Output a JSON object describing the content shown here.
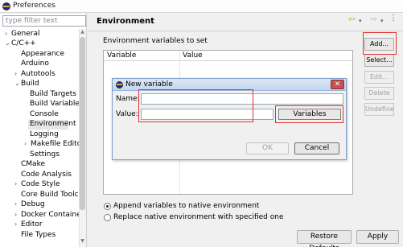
{
  "window": {
    "title": "Preferences"
  },
  "filter": {
    "placeholder": "type filter text"
  },
  "tree": {
    "items": [
      {
        "label": "General",
        "arrow": "›",
        "selected": false
      },
      {
        "label": "C/C++",
        "arrow": "⌄",
        "selected": false
      },
      {
        "label": "Appearance",
        "arrow": "",
        "selected": false
      },
      {
        "label": "Arduino",
        "arrow": "",
        "selected": false
      },
      {
        "label": "Autotools",
        "arrow": "›",
        "selected": false
      },
      {
        "label": "Build",
        "arrow": "⌄",
        "selected": false
      },
      {
        "label": "Build Targets",
        "arrow": "",
        "selected": false
      },
      {
        "label": "Build Variables",
        "arrow": "",
        "selected": false
      },
      {
        "label": "Console",
        "arrow": "",
        "selected": false
      },
      {
        "label": "Environment",
        "arrow": "",
        "selected": true
      },
      {
        "label": "Logging",
        "arrow": "",
        "selected": false
      },
      {
        "label": "Makefile Editor",
        "arrow": "›",
        "selected": false
      },
      {
        "label": "Settings",
        "arrow": "",
        "selected": false
      },
      {
        "label": "CMake",
        "arrow": "",
        "selected": false
      },
      {
        "label": "Code Analysis",
        "arrow": "",
        "selected": false
      },
      {
        "label": "Code Style",
        "arrow": "›",
        "selected": false
      },
      {
        "label": "Core Build Toolcha",
        "arrow": "",
        "selected": false
      },
      {
        "label": "Debug",
        "arrow": "›",
        "selected": false
      },
      {
        "label": "Docker Container",
        "arrow": "›",
        "selected": false
      },
      {
        "label": "Editor",
        "arrow": "›",
        "selected": false
      },
      {
        "label": "File Types",
        "arrow": "",
        "selected": false
      }
    ]
  },
  "page": {
    "title": "Environment"
  },
  "env": {
    "section_label": "Environment variables to set",
    "columns": [
      "Variable",
      "Value"
    ]
  },
  "buttons": {
    "add": "Add...",
    "select": "Select...",
    "edit": "Edit...",
    "delete": "Delete",
    "undefine": "Undefine"
  },
  "options": {
    "append": "Append variables to native environment",
    "replace": "Replace native environment with specified one",
    "selected": "append"
  },
  "footer": {
    "restore": "Restore Defaults",
    "apply": "Apply"
  },
  "dialog": {
    "title": "New variable",
    "name_label": "Name:",
    "name_value": "",
    "value_label": "Value:",
    "value_value": "",
    "variables_button": "Variables",
    "ok": "OK",
    "cancel": "Cancel",
    "close_glyph": "✕"
  }
}
